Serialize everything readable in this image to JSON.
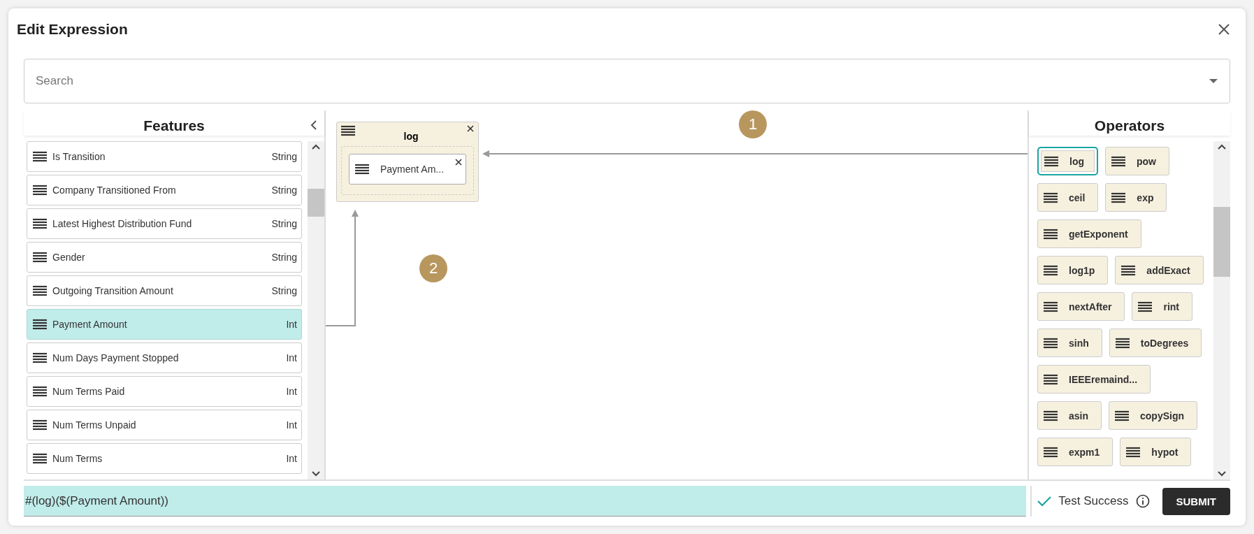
{
  "dialog": {
    "title": "Edit Expression"
  },
  "search": {
    "placeholder": "Search"
  },
  "features": {
    "title": "Features",
    "items": [
      {
        "name": "Is Transition",
        "type": "String",
        "selected": false
      },
      {
        "name": "Company Transitioned From",
        "type": "String",
        "selected": false
      },
      {
        "name": "Latest Highest Distribution Fund",
        "type": "String",
        "selected": false
      },
      {
        "name": "Gender",
        "type": "String",
        "selected": false
      },
      {
        "name": "Outgoing Transition Amount",
        "type": "String",
        "selected": false
      },
      {
        "name": "Payment Amount",
        "type": "Int",
        "selected": true
      },
      {
        "name": "Num Days Payment Stopped",
        "type": "Int",
        "selected": false
      },
      {
        "name": "Num Terms Paid",
        "type": "Int",
        "selected": false
      },
      {
        "name": "Num Terms Unpaid",
        "type": "Int",
        "selected": false
      },
      {
        "name": "Num Terms",
        "type": "Int",
        "selected": false
      }
    ]
  },
  "canvas": {
    "node": {
      "label": "log",
      "child": "Payment Am..."
    },
    "markers": [
      "1",
      "2"
    ]
  },
  "operators": {
    "title": "Operators",
    "items": [
      {
        "label": "log",
        "selected": true
      },
      {
        "label": "pow",
        "selected": false
      },
      {
        "label": "ceil",
        "selected": false
      },
      {
        "label": "exp",
        "selected": false
      },
      {
        "label": "getExponent",
        "selected": false
      },
      {
        "label": "log1p",
        "selected": false
      },
      {
        "label": "addExact",
        "selected": false
      },
      {
        "label": "nextAfter",
        "selected": false
      },
      {
        "label": "rint",
        "selected": false
      },
      {
        "label": "sinh",
        "selected": false
      },
      {
        "label": "toDegrees",
        "selected": false
      },
      {
        "label": "IEEEremaind...",
        "selected": false
      },
      {
        "label": "asin",
        "selected": false
      },
      {
        "label": "copySign",
        "selected": false
      },
      {
        "label": "expm1",
        "selected": false
      },
      {
        "label": "hypot",
        "selected": false
      }
    ]
  },
  "expression": {
    "value": "#(log)($(Payment Amount))"
  },
  "test": {
    "passed": true,
    "status": "Test Success"
  },
  "submit": {
    "label": "SUBMIT"
  }
}
